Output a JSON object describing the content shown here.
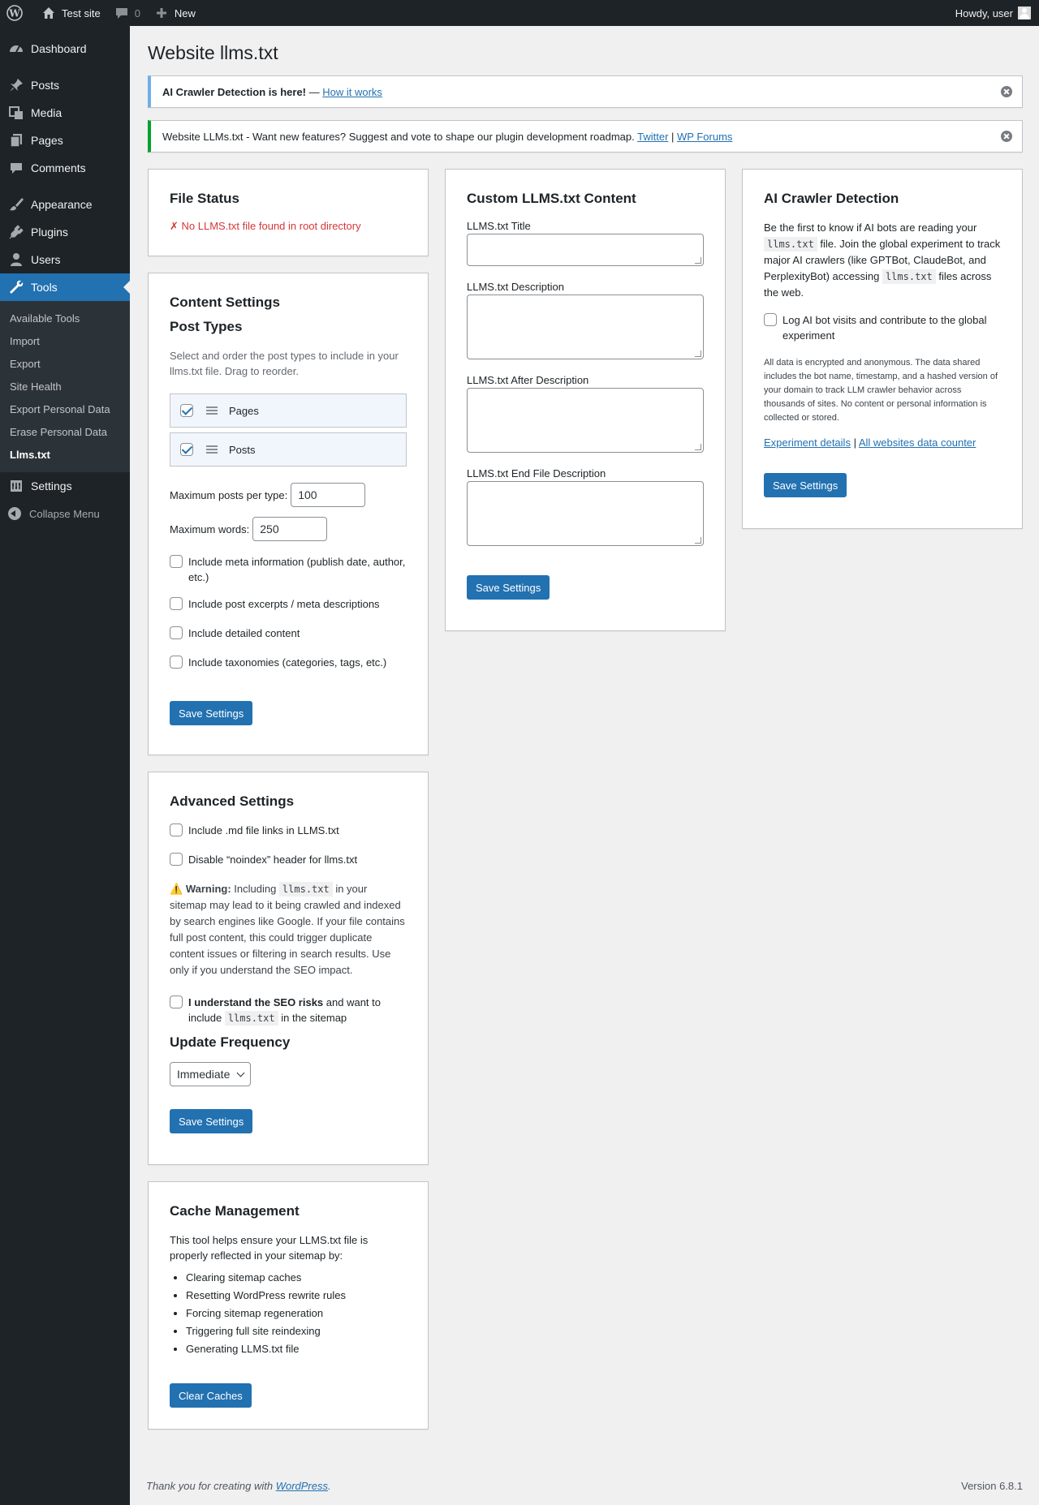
{
  "adminbar": {
    "site_name": "Test site",
    "comments_count": "0",
    "new_label": "New",
    "howdy": "Howdy, user"
  },
  "sidebar": {
    "items": [
      {
        "label": "Dashboard",
        "icon": "dashboard-icon"
      },
      {
        "label": "Posts",
        "icon": "pin-icon"
      },
      {
        "label": "Media",
        "icon": "media-icon"
      },
      {
        "label": "Pages",
        "icon": "pages-icon"
      },
      {
        "label": "Comments",
        "icon": "comment-icon"
      },
      {
        "label": "Appearance",
        "icon": "brush-icon"
      },
      {
        "label": "Plugins",
        "icon": "plug-icon"
      },
      {
        "label": "Users",
        "icon": "user-icon"
      },
      {
        "label": "Tools",
        "icon": "wrench-icon"
      },
      {
        "label": "Settings",
        "icon": "settings-icon"
      }
    ],
    "tools_submenu": [
      "Available Tools",
      "Import",
      "Export",
      "Site Health",
      "Export Personal Data",
      "Erase Personal Data",
      "Llms.txt"
    ],
    "collapse_label": "Collapse Menu"
  },
  "page": {
    "title": "Website llms.txt"
  },
  "notices": {
    "crawler": {
      "bold": "AI Crawler Detection is here!",
      "dash": " — ",
      "link": "How it works"
    },
    "roadmap": {
      "text": "Website LLMs.txt - Want new features? Suggest and vote to shape our plugin development roadmap. ",
      "twitter": "Twitter",
      "sep": " | ",
      "forums": "WP Forums"
    }
  },
  "file_status": {
    "title": "File Status",
    "message": "✗ No LLMS.txt file found in root directory"
  },
  "content_settings": {
    "title": "Content Settings",
    "post_types_title": "Post Types",
    "description": "Select and order the post types to include in your llms.txt file. Drag to reorder.",
    "post_types": [
      {
        "label": "Pages",
        "checked": true
      },
      {
        "label": "Posts",
        "checked": true
      }
    ],
    "max_posts_label": "Maximum posts per type:",
    "max_posts_value": "100",
    "max_words_label": "Maximum words:",
    "max_words_value": "250",
    "options": [
      "Include meta information (publish date, author, etc.)",
      "Include post excerpts / meta descriptions",
      "Include detailed content",
      "Include taxonomies (categories, tags, etc.)"
    ],
    "save_label": "Save Settings"
  },
  "advanced_settings": {
    "title": "Advanced Settings",
    "options": [
      "Include .md file links in LLMS.txt",
      "Disable “noindex” header for llms.txt"
    ],
    "warning_icon": "warning-icon",
    "warning_bold": "Warning:",
    "warning_pre": " Including ",
    "warning_code": "llms.txt",
    "warning_post": " in your sitemap may lead to it being crawled and indexed by search engines like Google. If your file contains full post content, this could trigger duplicate content issues or filtering in search results. Use only if you understand the SEO impact.",
    "seo_bold": "I understand the SEO risks",
    "seo_mid": " and want to include ",
    "seo_code": "llms.txt",
    "seo_post": " in the sitemap",
    "frequency_title": "Update Frequency",
    "frequency_value": "Immediate",
    "save_label": "Save Settings"
  },
  "cache_management": {
    "title": "Cache Management",
    "description": "This tool helps ensure your LLMS.txt file is properly reflected in your sitemap by:",
    "items": [
      "Clearing sitemap caches",
      "Resetting WordPress rewrite rules",
      "Forcing sitemap regeneration",
      "Triggering full site reindexing",
      "Generating LLMS.txt file"
    ],
    "button_label": "Clear Caches"
  },
  "custom_content": {
    "title": "Custom LLMS.txt Content",
    "fields": [
      {
        "label": "LLMS.txt Title"
      },
      {
        "label": "LLMS.txt Description"
      },
      {
        "label": "LLMS.txt After Description"
      },
      {
        "label": "LLMS.txt End File Description"
      }
    ],
    "save_label": "Save Settings"
  },
  "ai_crawler": {
    "title": "AI Crawler Detection",
    "p1_a": "Be the first to know if AI bots are reading your ",
    "p1_code1": "llms.txt",
    "p1_b": " file. Join the global experiment to track major AI crawlers (like GPTBot, ClaudeBot, and PerplexityBot) accessing ",
    "p1_code2": "llms.txt",
    "p1_c": " files across the web.",
    "checkbox_label": "Log AI bot visits and contribute to the global experiment",
    "privacy": "All data is encrypted and anonymous. The data shared includes the bot name, timestamp, and a hashed version of your domain to track LLM crawler behavior across thousands of sites. No content or personal information is collected or stored.",
    "link1": "Experiment details",
    "link_sep": " | ",
    "link2": "All websites data counter",
    "save_label": "Save Settings"
  },
  "footer": {
    "thanks_pre": "Thank you for creating with ",
    "thanks_link": "WordPress",
    "thanks_post": ".",
    "version": "Version 6.8.1"
  }
}
